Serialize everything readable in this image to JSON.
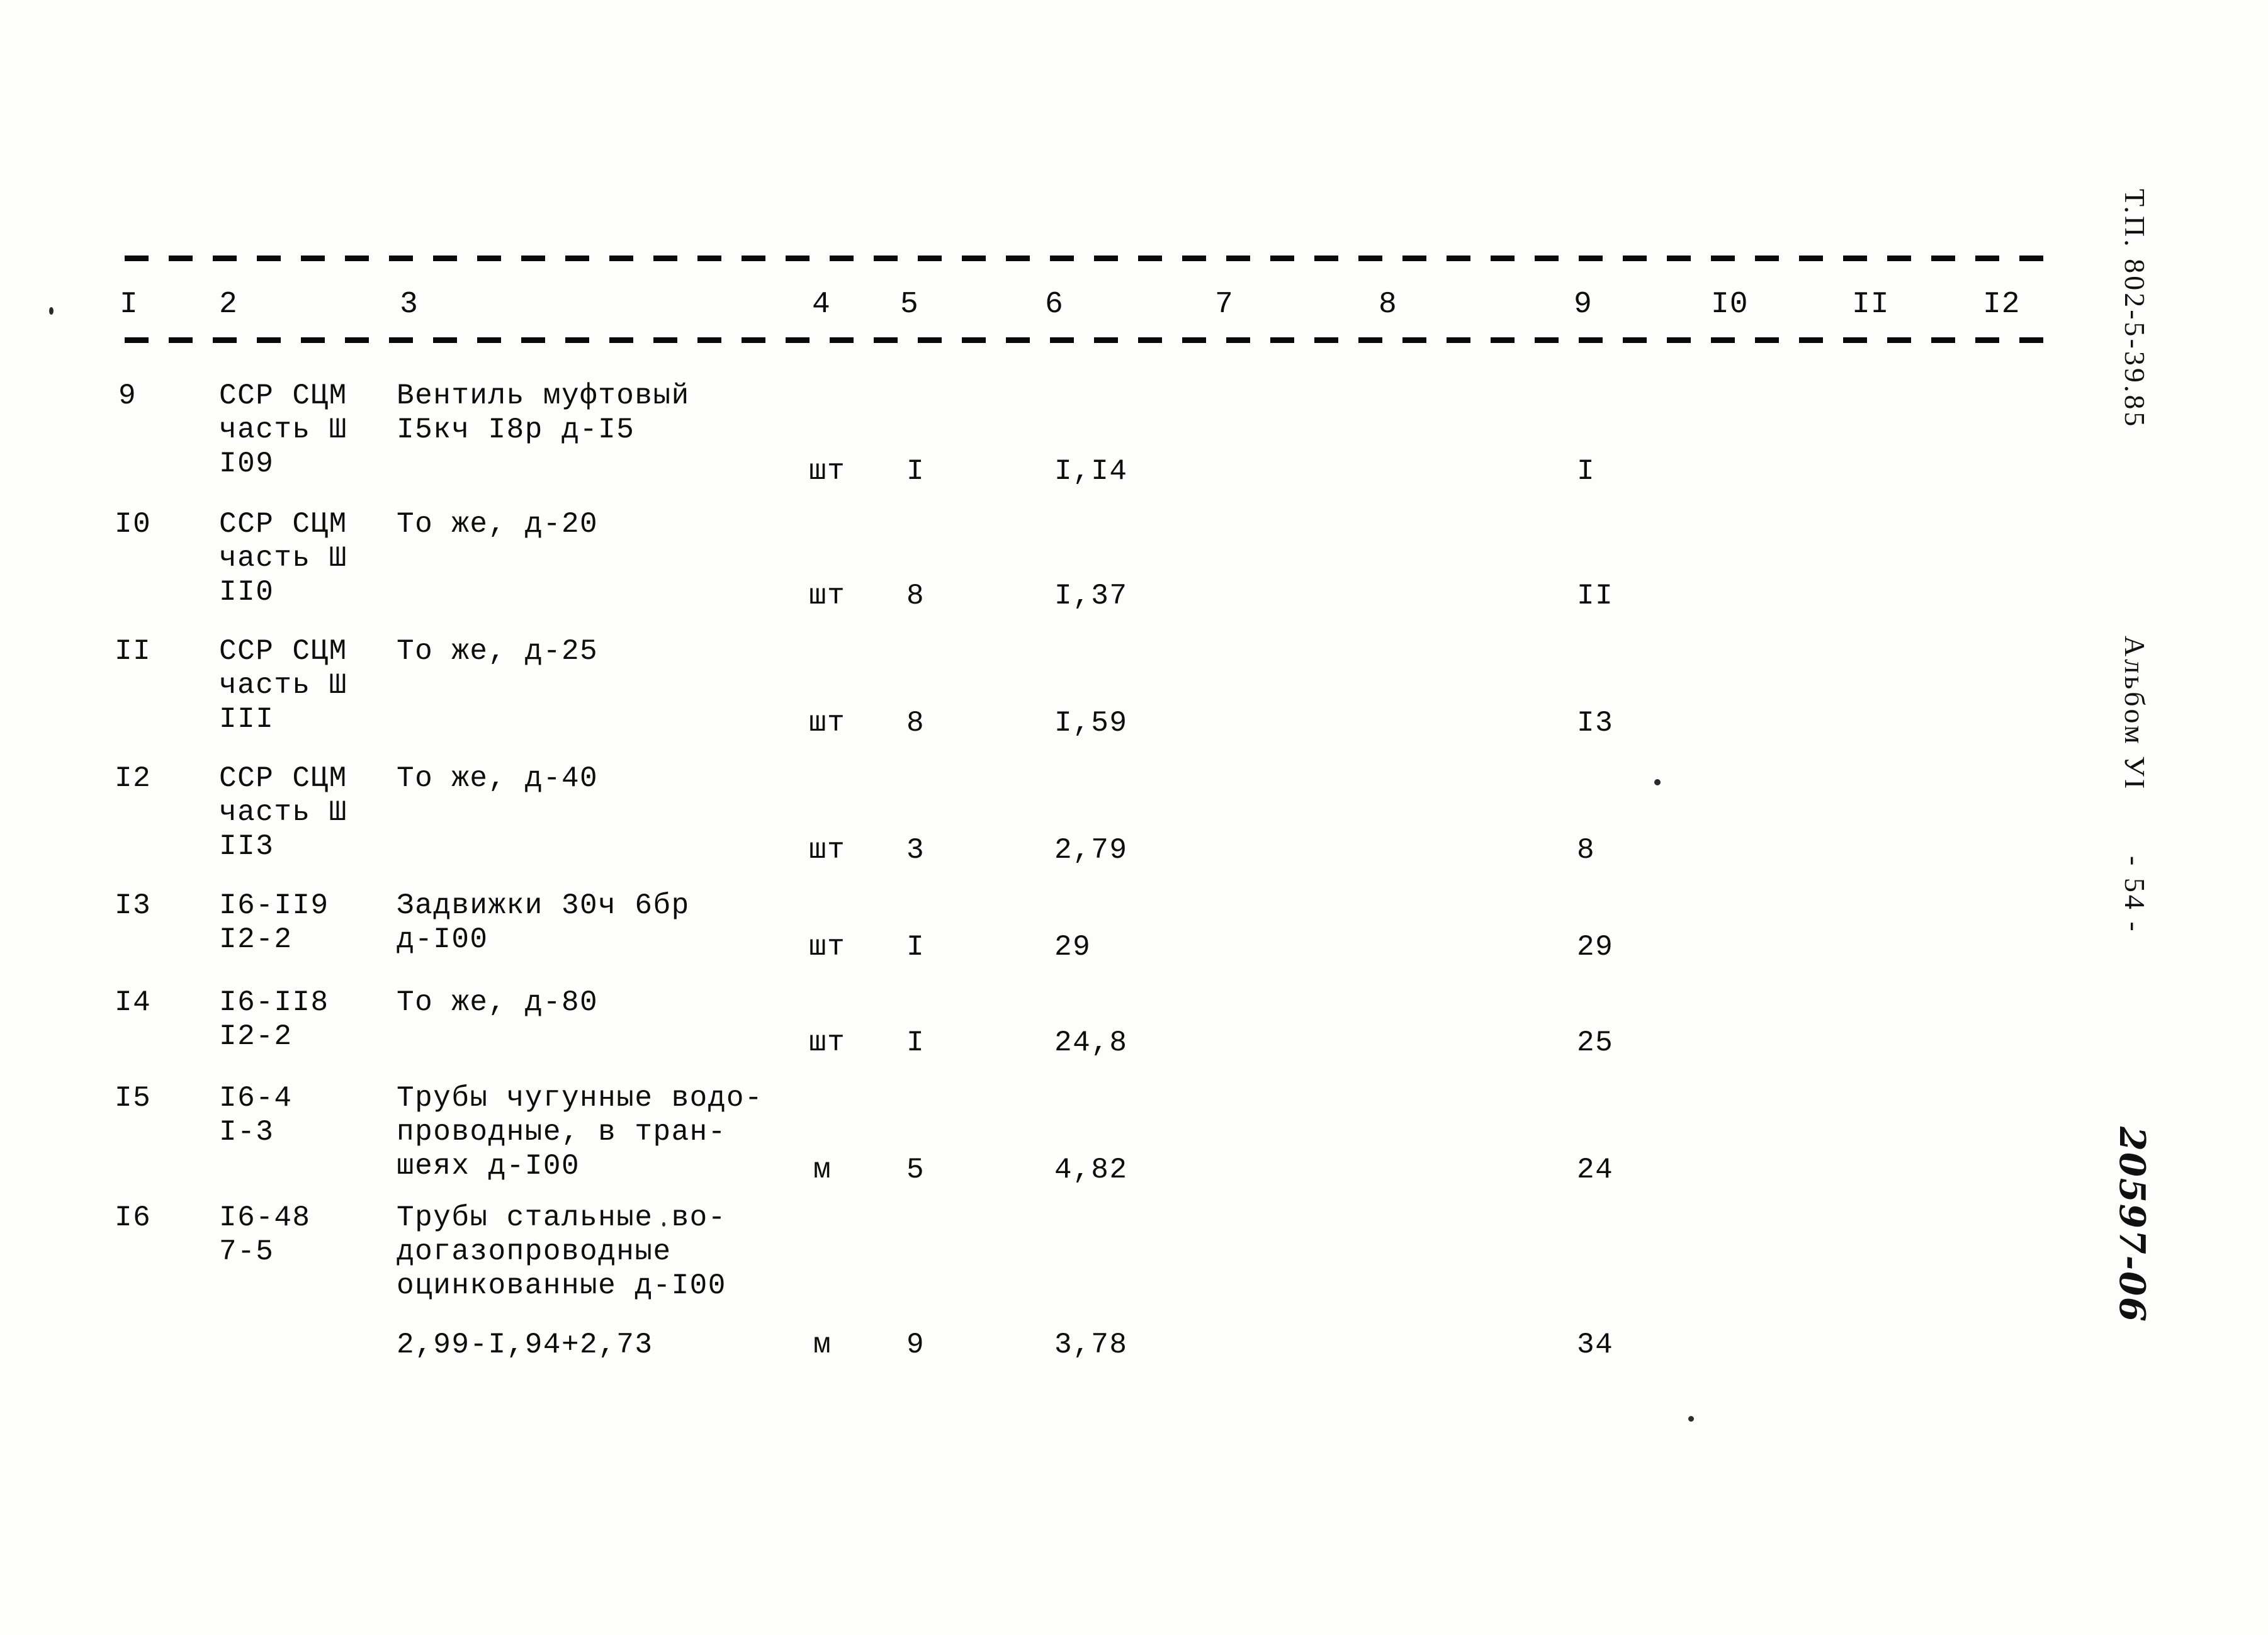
{
  "document": {
    "type": "soviet-technical-estimate-table",
    "margin_stamps": {
      "project_code": "Т.П. 802-5-39.85",
      "album": "Альбом УI",
      "page_number": "- 54 -",
      "archive_number": "20597-06"
    }
  },
  "table": {
    "column_headers": [
      "I",
      "2",
      "3",
      "4",
      "5",
      "6",
      "7",
      "8",
      "9",
      "I0",
      "II",
      "I2"
    ],
    "rows": [
      {
        "c1": "9",
        "c2": [
          "ССР СЦМ",
          "часть Ш",
          "I09"
        ],
        "c3": [
          "Вентиль муфтовый",
          "I5кч I8р д-I5"
        ],
        "c4": "шт",
        "c5": "I",
        "c6": "I,I4",
        "c7": "",
        "c8": "",
        "c9": "I",
        "c10": "",
        "c11": "",
        "c12": ""
      },
      {
        "c1": "I0",
        "c2": [
          "ССР СЦМ",
          "часть Ш",
          "II0"
        ],
        "c3": [
          "То же, д-20"
        ],
        "c4": "шт",
        "c5": "8",
        "c6": "I,37",
        "c7": "",
        "c8": "",
        "c9": "II",
        "c10": "",
        "c11": "",
        "c12": ""
      },
      {
        "c1": "II",
        "c2": [
          "ССР СЦМ",
          "часть Ш",
          "III"
        ],
        "c3": [
          "То же, д-25"
        ],
        "c4": "шт",
        "c5": "8",
        "c6": "I,59",
        "c7": "",
        "c8": "",
        "c9": "I3",
        "c10": "",
        "c11": "",
        "c12": ""
      },
      {
        "c1": "I2",
        "c2": [
          "ССР СЦМ",
          "часть Ш",
          "II3"
        ],
        "c3": [
          "То же, д-40"
        ],
        "c4": "шт",
        "c5": "3",
        "c6": "2,79",
        "c7": "",
        "c8": "",
        "c9": "8",
        "c10": "",
        "c11": "",
        "c12": ""
      },
      {
        "c1": "I3",
        "c2": [
          "I6-II9",
          "I2-2"
        ],
        "c3": [
          "Задвижки 30ч 6бр",
          "д-I00"
        ],
        "c4": "шт",
        "c5": "I",
        "c6": "29",
        "c7": "",
        "c8": "",
        "c9": "29",
        "c10": "",
        "c11": "",
        "c12": ""
      },
      {
        "c1": "I4",
        "c2": [
          "I6-II8",
          "I2-2"
        ],
        "c3": [
          "То же, д-80"
        ],
        "c4": "шт",
        "c5": "I",
        "c6": "24,8",
        "c7": "",
        "c8": "",
        "c9": "25",
        "c10": "",
        "c11": "",
        "c12": ""
      },
      {
        "c1": "I5",
        "c2": [
          "I6-4",
          "I-3"
        ],
        "c3": [
          "Трубы чугунные водо-",
          "проводные, в тран-",
          "шеях д-I00"
        ],
        "c4": "м",
        "c5": "5",
        "c6": "4,82",
        "c7": "",
        "c8": "",
        "c9": "24",
        "c10": "",
        "c11": "",
        "c12": ""
      },
      {
        "c1": "I6",
        "c2": [
          "I6-48",
          "7-5"
        ],
        "c3": [
          "Трубы стальные во-",
          "догазопроводные",
          "оцинкованные д-I00",
          "",
          "2,99-I,94+2,73"
        ],
        "c4": "м",
        "c5": "9",
        "c6": "3,78",
        "c7": "",
        "c8": "",
        "c9": "34",
        "c10": "",
        "c11": "",
        "c12": ""
      }
    ]
  }
}
